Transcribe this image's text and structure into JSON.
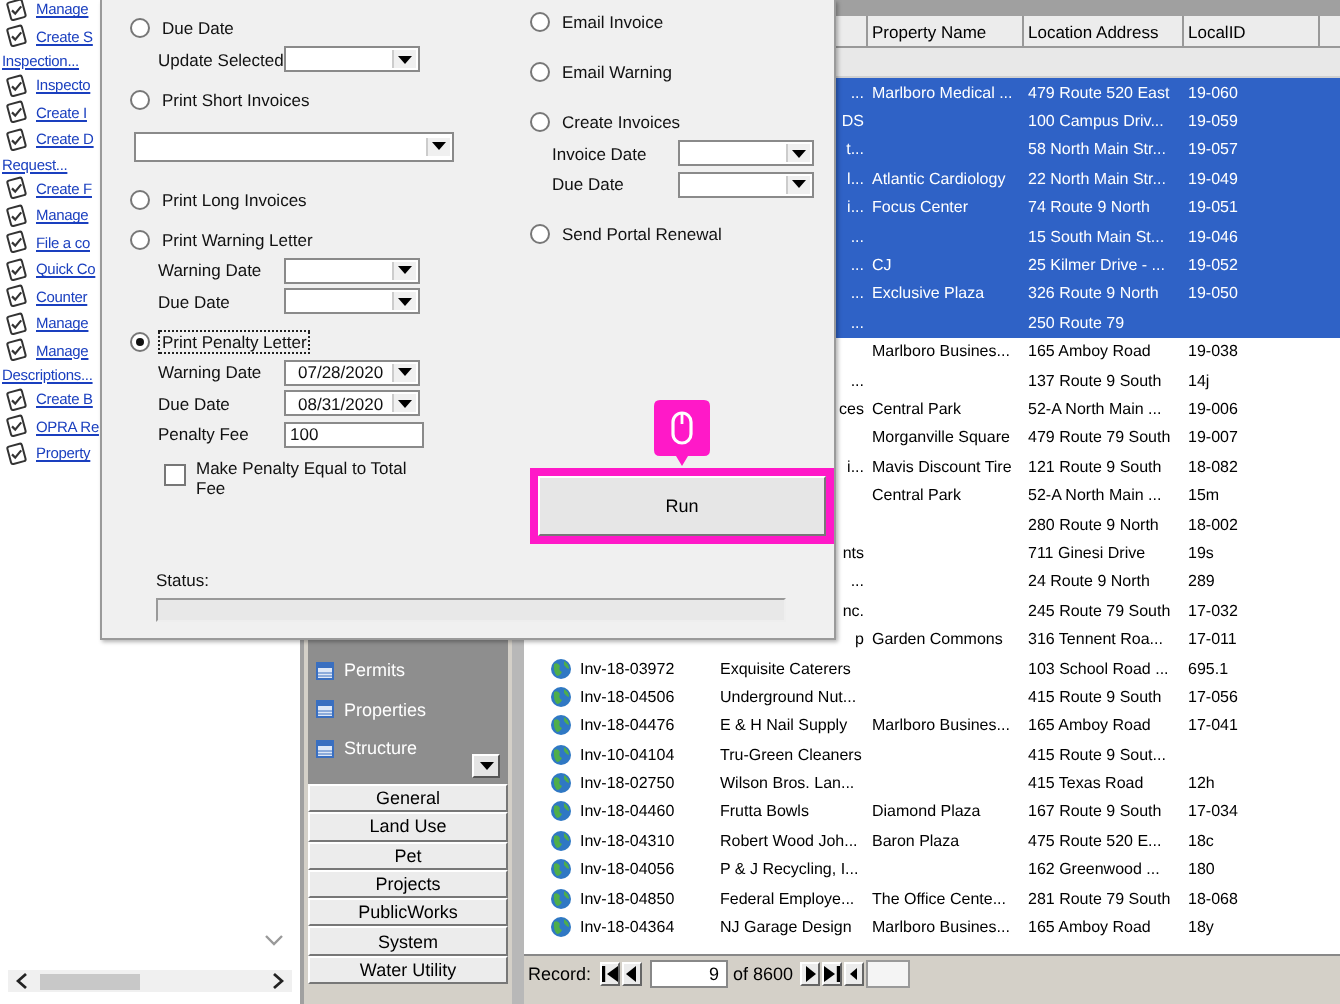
{
  "task_list": {
    "items": [
      {
        "label": "Manage"
      },
      {
        "label": "Create S",
        "second_line": "Inspection..."
      },
      {
        "label": "Inspecto"
      },
      {
        "label": "Create I"
      },
      {
        "label": "Create D",
        "second_line": "Request..."
      },
      {
        "label": "Create F"
      },
      {
        "label": "Manage"
      },
      {
        "label": "File a co"
      },
      {
        "label": "Quick Co"
      },
      {
        "label": "Counter"
      },
      {
        "label": "Manage"
      },
      {
        "label": "Manage",
        "second_line": "Descriptions..."
      },
      {
        "label": "Create B"
      },
      {
        "label": "OPRA Re"
      },
      {
        "label": "Property"
      }
    ]
  },
  "nav_panel": {
    "items": [
      {
        "label": "Permits"
      },
      {
        "label": "Properties"
      },
      {
        "label": "Structure"
      }
    ],
    "buttons": [
      "General",
      "Land Use",
      "Pet",
      "Projects",
      "PublicWorks",
      "System",
      "Water Utility"
    ]
  },
  "grid": {
    "columns": [
      "Property Name",
      "Location Address",
      "LocalID"
    ],
    "rows": [
      {
        "selected": true,
        "name_tail": "...",
        "property": "Marlboro Medical ...",
        "address": "479 Route 520 East",
        "local_id": "19-060"
      },
      {
        "selected": true,
        "name_tail": "DS",
        "address": "100 Campus Driv...",
        "local_id": "19-059"
      },
      {
        "selected": true,
        "name_tail": "t...",
        "address": "58 North Main Str...",
        "local_id": "19-057"
      },
      {
        "selected": true,
        "name_tail": "l...",
        "property": "Atlantic Cardiology",
        "address": "22 North Main Str...",
        "local_id": "19-049"
      },
      {
        "selected": true,
        "name_tail": "i...",
        "property": "Focus Center",
        "address": "74 Route 9 North",
        "local_id": "19-051"
      },
      {
        "selected": true,
        "name_tail": "...",
        "address": "15 South Main St...",
        "local_id": "19-046"
      },
      {
        "selected": true,
        "name_tail": "...",
        "property": "CJ",
        "address": "25 Kilmer Drive - ...",
        "local_id": "19-052"
      },
      {
        "selected": true,
        "name_tail": "...",
        "property": "Exclusive Plaza",
        "address": "326 Route 9 North",
        "local_id": "19-050"
      },
      {
        "selected": true,
        "name_tail": "...",
        "address": "250 Route 79"
      },
      {
        "selected": false,
        "property": "Marlboro Busines...",
        "address": "165 Amboy Road",
        "local_id": "19-038"
      },
      {
        "selected": false,
        "name_tail": "...",
        "address": "137 Route 9 South",
        "local_id": "14j"
      },
      {
        "selected": false,
        "name_tail": "ces",
        "property": "Central Park",
        "address": "52-A North Main ...",
        "local_id": "19-006"
      },
      {
        "selected": false,
        "property": "Morganville Square",
        "address": "479 Route 79 South",
        "local_id": "19-007"
      },
      {
        "selected": false,
        "name_tail": "i...",
        "property": "Mavis Discount Tire",
        "address": "121 Route 9 South",
        "local_id": "18-082"
      },
      {
        "selected": false,
        "property": "Central Park",
        "address": "52-A North Main ...",
        "local_id": "15m"
      },
      {
        "selected": false,
        "address": "280 Route 9 North",
        "local_id": "18-002"
      },
      {
        "selected": false,
        "name_tail": "nts",
        "address": "711 Ginesi Drive",
        "local_id": "19s"
      },
      {
        "selected": false,
        "name_tail": "...",
        "address": "24 Route 9 North",
        "local_id": "289"
      },
      {
        "selected": false,
        "name_tail": "nc.",
        "address": "245 Route 79 South",
        "local_id": "17-032"
      },
      {
        "selected": false,
        "name_tail": "p",
        "property": "Garden Commons",
        "address": "316 Tennent Roa...",
        "local_id": "17-011"
      },
      {
        "selected": false,
        "invoice": "Inv-18-03972",
        "name": "Exquisite Caterers",
        "address": "103 School Road ...",
        "local_id": "695.1"
      },
      {
        "selected": false,
        "invoice": "Inv-18-04506",
        "name": "Underground Nut...",
        "address": "415 Route 9 South",
        "local_id": "17-056"
      },
      {
        "selected": false,
        "invoice": "Inv-18-04476",
        "name": "E & H Nail Supply",
        "property": "Marlboro Busines...",
        "address": "165 Amboy Road",
        "local_id": "17-041"
      },
      {
        "selected": false,
        "invoice": "Inv-10-04104",
        "name": "Tru-Green Cleaners",
        "address": "415 Route 9 Sout..."
      },
      {
        "selected": false,
        "invoice": "Inv-18-02750",
        "name": "Wilson Bros. Lan...",
        "address": "415 Texas Road",
        "local_id": "12h"
      },
      {
        "selected": false,
        "invoice": "Inv-18-04460",
        "name": "Frutta Bowls",
        "property": "Diamond Plaza",
        "address": "167 Route 9 South",
        "local_id": "17-034"
      },
      {
        "selected": false,
        "invoice": "Inv-18-04310",
        "name": "Robert Wood Joh...",
        "property": "Baron Plaza",
        "address": "475 Route 520 E...",
        "local_id": "18c"
      },
      {
        "selected": false,
        "invoice": "Inv-18-04056",
        "name": "P & J Recycling, I...",
        "address": "162 Greenwood ...",
        "local_id": "180"
      },
      {
        "selected": false,
        "invoice": "Inv-18-04850",
        "name": "Federal Employe...",
        "property": "The Office Cente...",
        "address": "281 Route 79 South",
        "local_id": "18-068"
      },
      {
        "selected": false,
        "invoice": "Inv-18-04364",
        "name": "NJ Garage Design",
        "property": "Marlboro Busines...",
        "address": "165 Amboy Road",
        "local_id": "18y"
      }
    ],
    "record_bar": {
      "label": "Record:",
      "current": "9",
      "total": "of 8600"
    }
  },
  "dialog": {
    "left_options": [
      {
        "label": "Due Date",
        "selected": false,
        "focused": false,
        "fields": [
          {
            "kind": "combo",
            "label": "Update Selected"
          }
        ]
      },
      {
        "label": "Print Short Invoices",
        "selected": false,
        "focused": false,
        "fields": [
          {
            "kind": "combo"
          }
        ]
      },
      {
        "label": "Print Long Invoices",
        "selected": false,
        "focused": false
      },
      {
        "label": "Print Warning Letter",
        "selected": false,
        "focused": false,
        "fields": [
          {
            "kind": "combo",
            "label": "Warning Date"
          },
          {
            "kind": "combo",
            "label": "Due Date"
          }
        ]
      },
      {
        "label": "Print Penalty Letter",
        "selected": true,
        "focused": true,
        "fields": [
          {
            "kind": "combo",
            "label": "Warning Date",
            "value": "07/28/2020"
          },
          {
            "kind": "combo",
            "label": "Due Date",
            "value": "08/31/2020"
          },
          {
            "kind": "text",
            "label": "Penalty Fee",
            "value": "100"
          },
          {
            "kind": "checkbox",
            "label": "Make Penalty Equal to Total Fee",
            "checked": false
          }
        ]
      }
    ],
    "right_options": [
      {
        "label": "Email Invoice",
        "selected": false,
        "focused": false
      },
      {
        "label": "Email Warning",
        "selected": false,
        "focused": false
      },
      {
        "label": "Create Invoices",
        "selected": false,
        "focused": false,
        "fields": [
          {
            "kind": "combo",
            "label": "Invoice Date"
          },
          {
            "kind": "combo",
            "label": "Due Date"
          }
        ]
      },
      {
        "label": "Send Portal Renewal",
        "selected": false,
        "focused": false
      }
    ],
    "run_button": {
      "label": "Run",
      "highlighted": true
    },
    "status_label": "Status:"
  }
}
